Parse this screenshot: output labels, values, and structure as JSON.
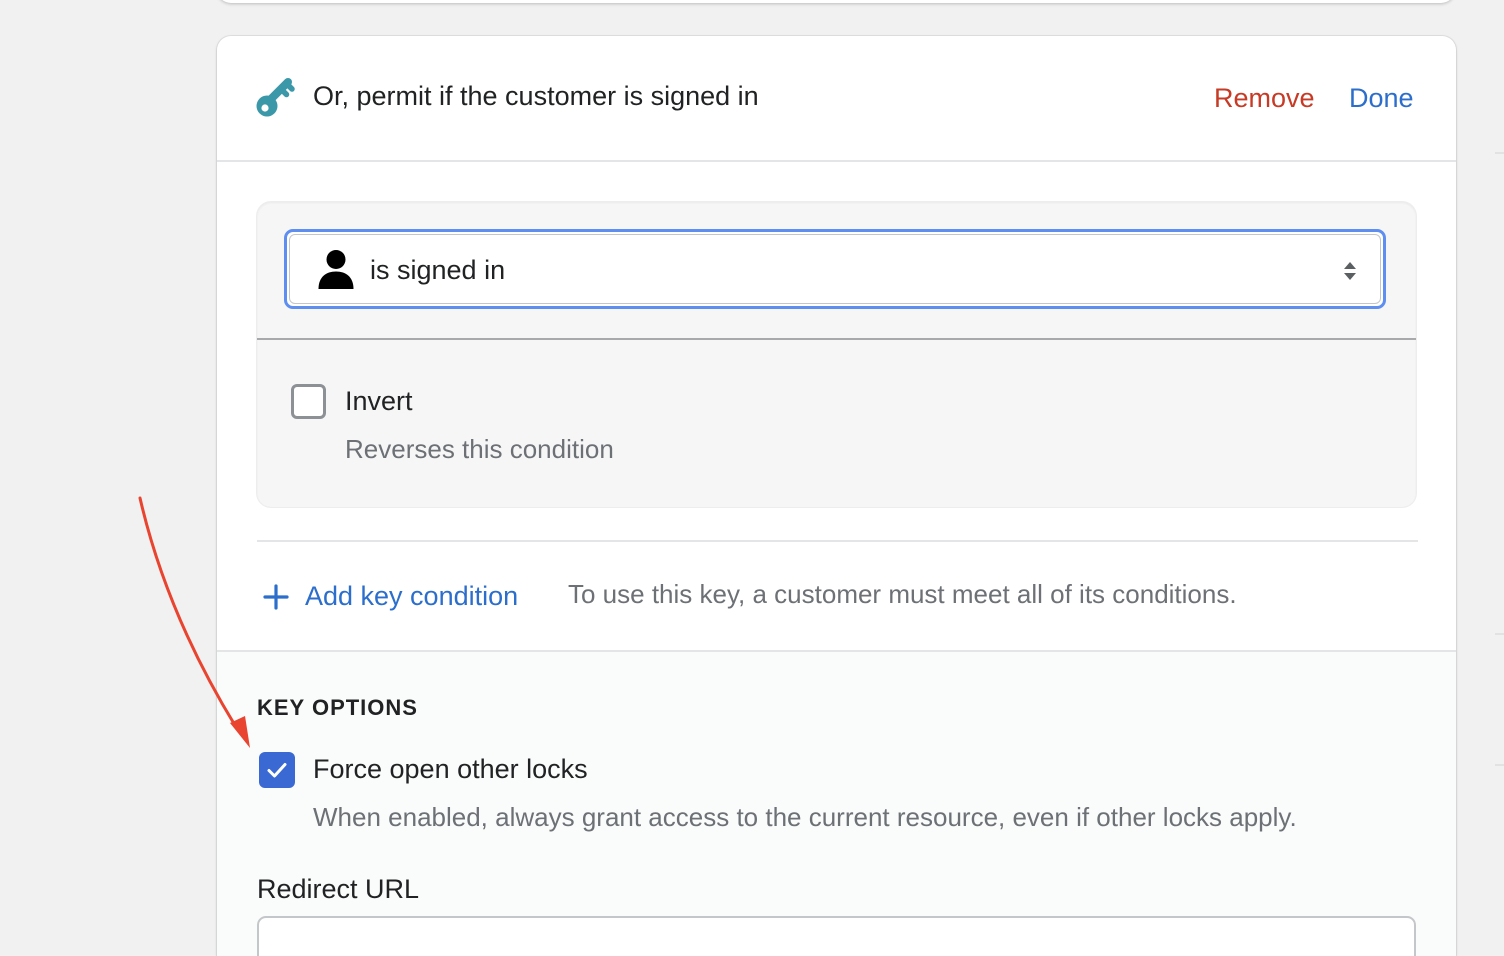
{
  "colors": {
    "accent": "#2c6ecb",
    "destructive": "#c73a25",
    "key_icon": "#3b98a8",
    "checkbox_checked": "#3a69d3",
    "focus_ring": "#5e8ef0",
    "annotation_arrow": "#e8442f"
  },
  "key_card": {
    "icon": "key-icon",
    "title": "Or, permit if the customer is signed in",
    "remove_label": "Remove",
    "done_label": "Done"
  },
  "condition": {
    "select": {
      "icon": "person-icon",
      "value": "is signed in",
      "arrows_icon": "select-arrows-icon"
    },
    "invert": {
      "checked": false,
      "label": "Invert",
      "help": "Reverses this condition"
    }
  },
  "add_condition": {
    "icon": "plus-icon",
    "label": "Add key condition",
    "help": "To use this key, a customer must meet all of its conditions."
  },
  "key_options": {
    "heading": "KEY OPTIONS",
    "force_open": {
      "checked": true,
      "label": "Force open other locks",
      "help": "When enabled, always grant access to the current resource, even if other locks apply."
    },
    "redirect_url": {
      "label": "Redirect URL",
      "value": ""
    }
  },
  "annotation": {
    "icon": "annotation-arrow-icon",
    "points_to": "force-open-checkbox"
  }
}
